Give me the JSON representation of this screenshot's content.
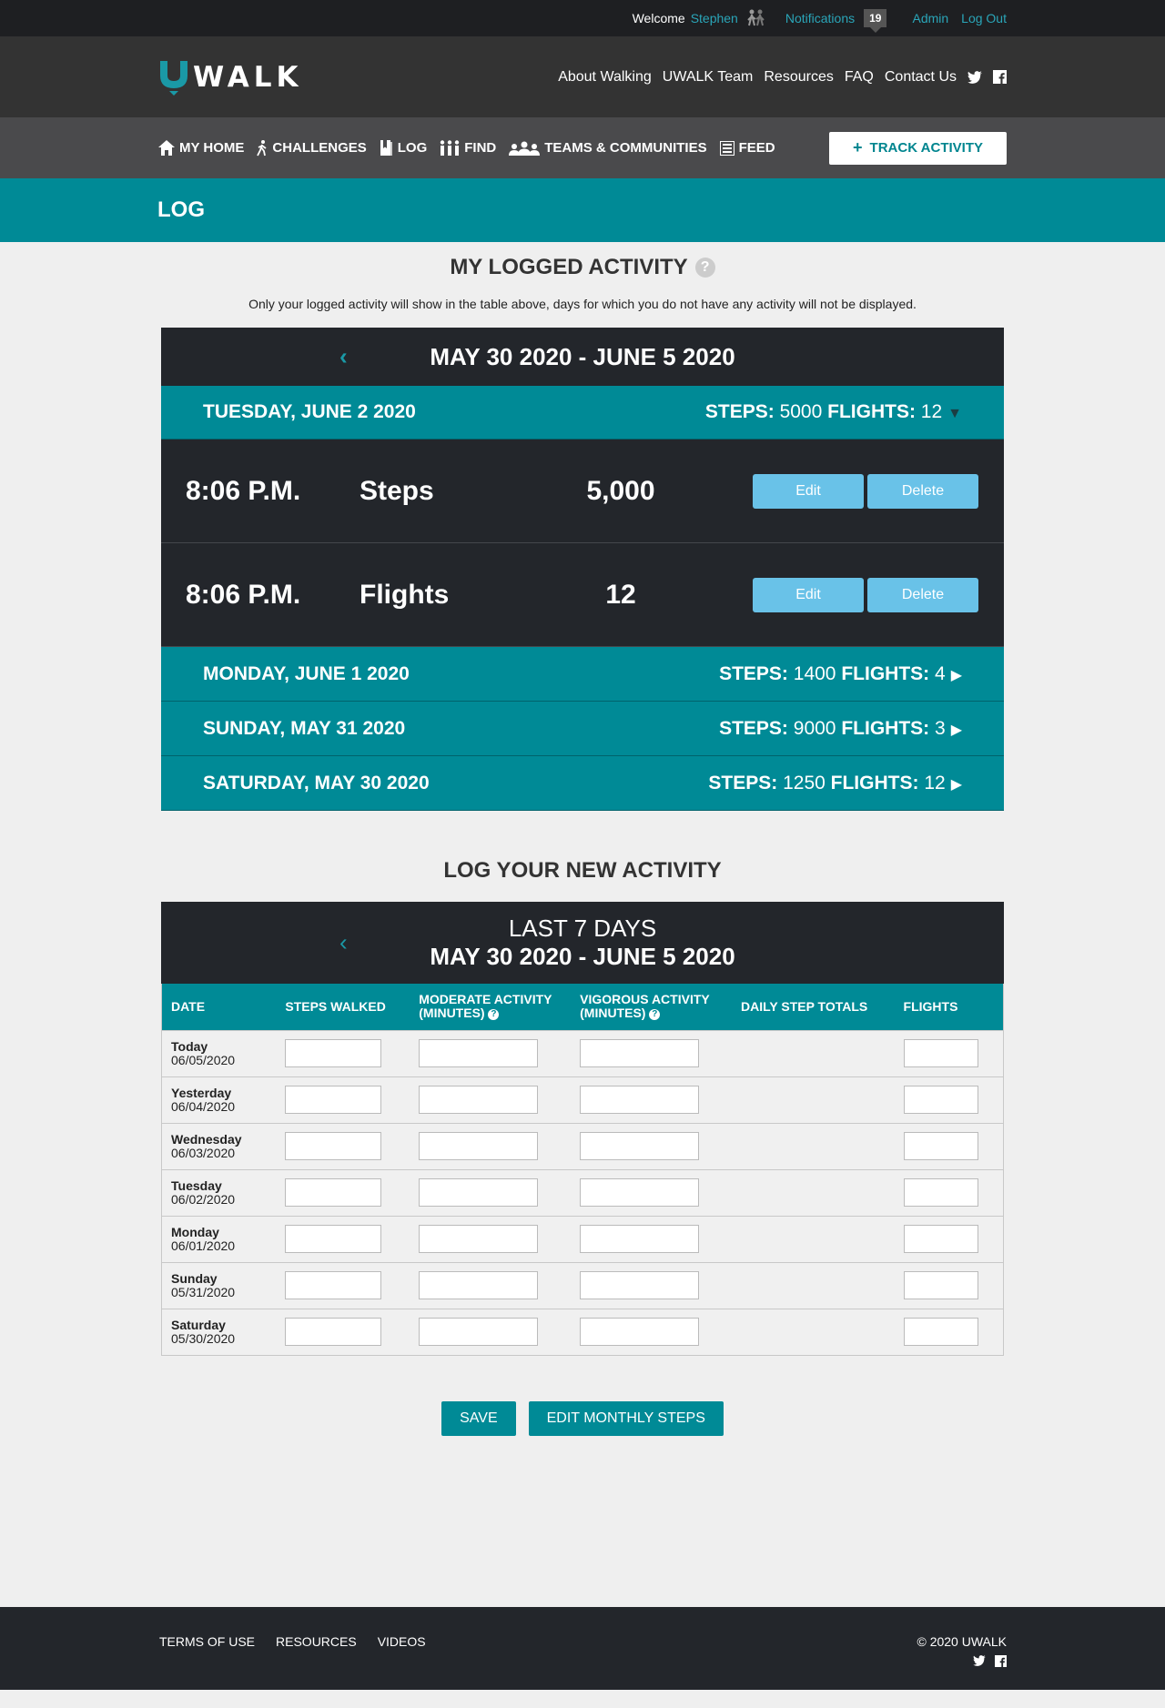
{
  "topbar": {
    "welcome": "Welcome",
    "username": "Stephen",
    "notifications_label": "Notifications",
    "notifications_count": "19",
    "admin_label": "Admin",
    "logout_label": "Log Out"
  },
  "header": {
    "logo_text": "WALK",
    "nav": [
      "About Walking",
      "UWALK Team",
      "Resources",
      "FAQ",
      "Contact Us"
    ]
  },
  "subnav": {
    "items": [
      "MY HOME",
      "CHALLENGES",
      "LOG",
      "FIND",
      "TEAMS & COMMUNITIES",
      "FEED"
    ],
    "track_label": "TRACK ACTIVITY"
  },
  "page": {
    "title": "LOG"
  },
  "logged": {
    "title": "MY LOGGED ACTIVITY",
    "description": "Only your logged activity will show in the table above, days for which you do not have any activity will not be displayed.",
    "week_range": "MAY 30 2020 - JUNE 5 2020",
    "steps_key": "STEPS:",
    "flights_key": "FLIGHTS:",
    "days": [
      {
        "label": "TUESDAY, JUNE 2 2020",
        "steps": "5000",
        "flights": "12"
      },
      {
        "label": "MONDAY, JUNE 1 2020",
        "steps": "1400",
        "flights": "4"
      },
      {
        "label": "SUNDAY, MAY 31 2020",
        "steps": "9000",
        "flights": "3"
      },
      {
        "label": "SATURDAY, MAY 30 2020",
        "steps": "1250",
        "flights": "12"
      }
    ],
    "entries": [
      {
        "time": "8:06 P.M.",
        "metric": "Steps",
        "value": "5,000"
      },
      {
        "time": "8:06 P.M.",
        "metric": "Flights",
        "value": "12"
      }
    ],
    "edit_label": "Edit",
    "delete_label": "Delete"
  },
  "newlog": {
    "title": "LOG YOUR NEW ACTIVITY",
    "range_line1": "LAST 7 DAYS",
    "range_line2": "MAY 30 2020 - JUNE 5 2020",
    "columns": {
      "date": "DATE",
      "steps": "STEPS WALKED",
      "moderate_1": "MODERATE ACTIVITY",
      "moderate_2": "(MINUTES)",
      "vigorous_1": "VIGOROUS ACTIVITY",
      "vigorous_2": "(MINUTES)",
      "totals": "DAILY STEP TOTALS",
      "flights": "FLIGHTS"
    },
    "rows": [
      {
        "day": "Today",
        "date": "06/05/2020"
      },
      {
        "day": "Yesterday",
        "date": "06/04/2020"
      },
      {
        "day": "Wednesday",
        "date": "06/03/2020"
      },
      {
        "day": "Tuesday",
        "date": "06/02/2020"
      },
      {
        "day": "Monday",
        "date": "06/01/2020"
      },
      {
        "day": "Sunday",
        "date": "05/31/2020"
      },
      {
        "day": "Saturday",
        "date": "05/30/2020"
      }
    ],
    "save_label": "SAVE",
    "edit_monthly_label": "EDIT MONTHLY STEPS"
  },
  "footer": {
    "links": [
      "TERMS OF USE",
      "RESOURCES",
      "VIDEOS"
    ],
    "copyright": "© 2020 UWALK"
  },
  "icons": {
    "home": "home-icon",
    "challenges": "walker-icon",
    "log": "book-icon",
    "find": "people-icon",
    "teams": "group-icon",
    "feed": "list-icon",
    "twitter": "twitter-icon",
    "facebook": "facebook-icon"
  },
  "colors": {
    "teal": "#008a96",
    "dark": "#23262b",
    "button_blue": "#69c2e8"
  }
}
